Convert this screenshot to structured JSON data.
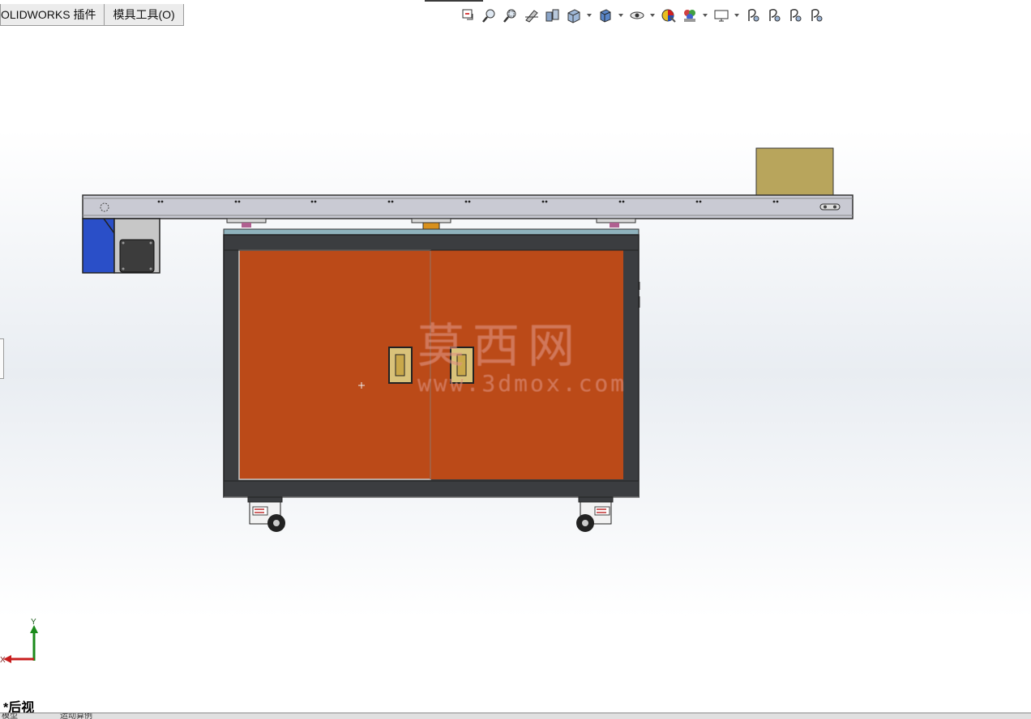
{
  "menu_tabs": [
    "OLIDWORKS 插件",
    "模具工具(O)"
  ],
  "toolbar_icons": [
    "view-previous-icon",
    "zoom-to-fit-icon",
    "zoom-to-area-icon",
    "section-view-icon",
    "dynamic-annotation-icon",
    "view-orientation-icon",
    "display-style-icon",
    "hide-show-icon",
    "edit-appearance-icon",
    "apply-scene-icon",
    "view-settings-icon",
    "display-pane-1-icon",
    "display-pane-2-icon",
    "display-pane-3-icon",
    "display-pane-4-icon"
  ],
  "view_label": "*后视",
  "triad": {
    "y_label": "Y",
    "x_label": "X"
  },
  "watermark": {
    "chinese": "莫西网",
    "url": "www.3dmox.com"
  },
  "bottom_tabs": [
    "模型",
    "运动算例"
  ],
  "colors": {
    "cabinet_orange": "#bb4a18",
    "cabinet_frame": "#3b3d40",
    "conveyor_gray": "#c9cad3",
    "motor_blue": "#2a4fc8",
    "box_tan": "#b8a55c"
  }
}
